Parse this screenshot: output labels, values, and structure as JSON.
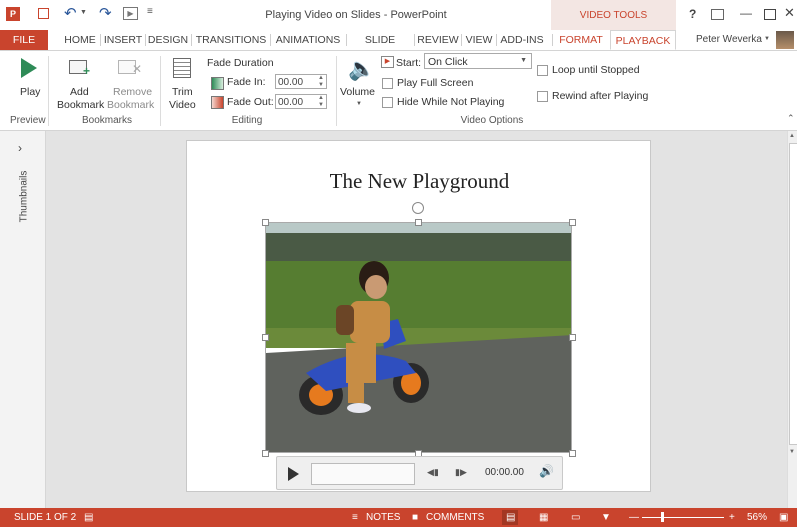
{
  "window": {
    "title": "Playing Video on Slides - PowerPoint",
    "context_group": "VIDEO TOOLS",
    "help": "?",
    "controls": [
      "—",
      "□",
      "✕"
    ]
  },
  "tabs": [
    "FILE",
    "HOME",
    "INSERT",
    "DESIGN",
    "TRANSITIONS",
    "ANIMATIONS",
    "SLIDE SHOW",
    "REVIEW",
    "VIEW",
    "ADD-INS",
    "FORMAT",
    "PLAYBACK"
  ],
  "user": "Peter Weverka",
  "ribbon": {
    "play": "Play",
    "preview_group": "Preview",
    "add_bookmark": [
      "Add",
      "Bookmark"
    ],
    "remove_bookmark": [
      "Remove",
      "Bookmark"
    ],
    "bookmarks_group": "Bookmarks",
    "trim": [
      "Trim",
      "Video"
    ],
    "fade_duration": "Fade Duration",
    "fade_in": "Fade In:",
    "fade_in_value": "00.00",
    "fade_out": "Fade Out:",
    "fade_out_value": "00.00",
    "editing_group": "Editing",
    "volume": "Volume",
    "start_label": "Start:",
    "start_value": "On Click",
    "play_full_screen": "Play Full Screen",
    "hide_while_not_playing": "Hide While Not Playing",
    "loop_until_stopped": "Loop until Stopped",
    "rewind_after_playing": "Rewind after Playing",
    "video_options_group": "Video Options"
  },
  "thumbnails_label": "Thumbnails",
  "slide": {
    "title": "The New Playground",
    "time": "00:00.00"
  },
  "status": {
    "slide": "SLIDE 1 OF 2",
    "notes": "NOTES",
    "comments": "COMMENTS",
    "zoom": "56%"
  },
  "colors": {
    "file_tab": "#c9442d",
    "status_bar": "#c9442d",
    "accent": "#c9442d"
  }
}
